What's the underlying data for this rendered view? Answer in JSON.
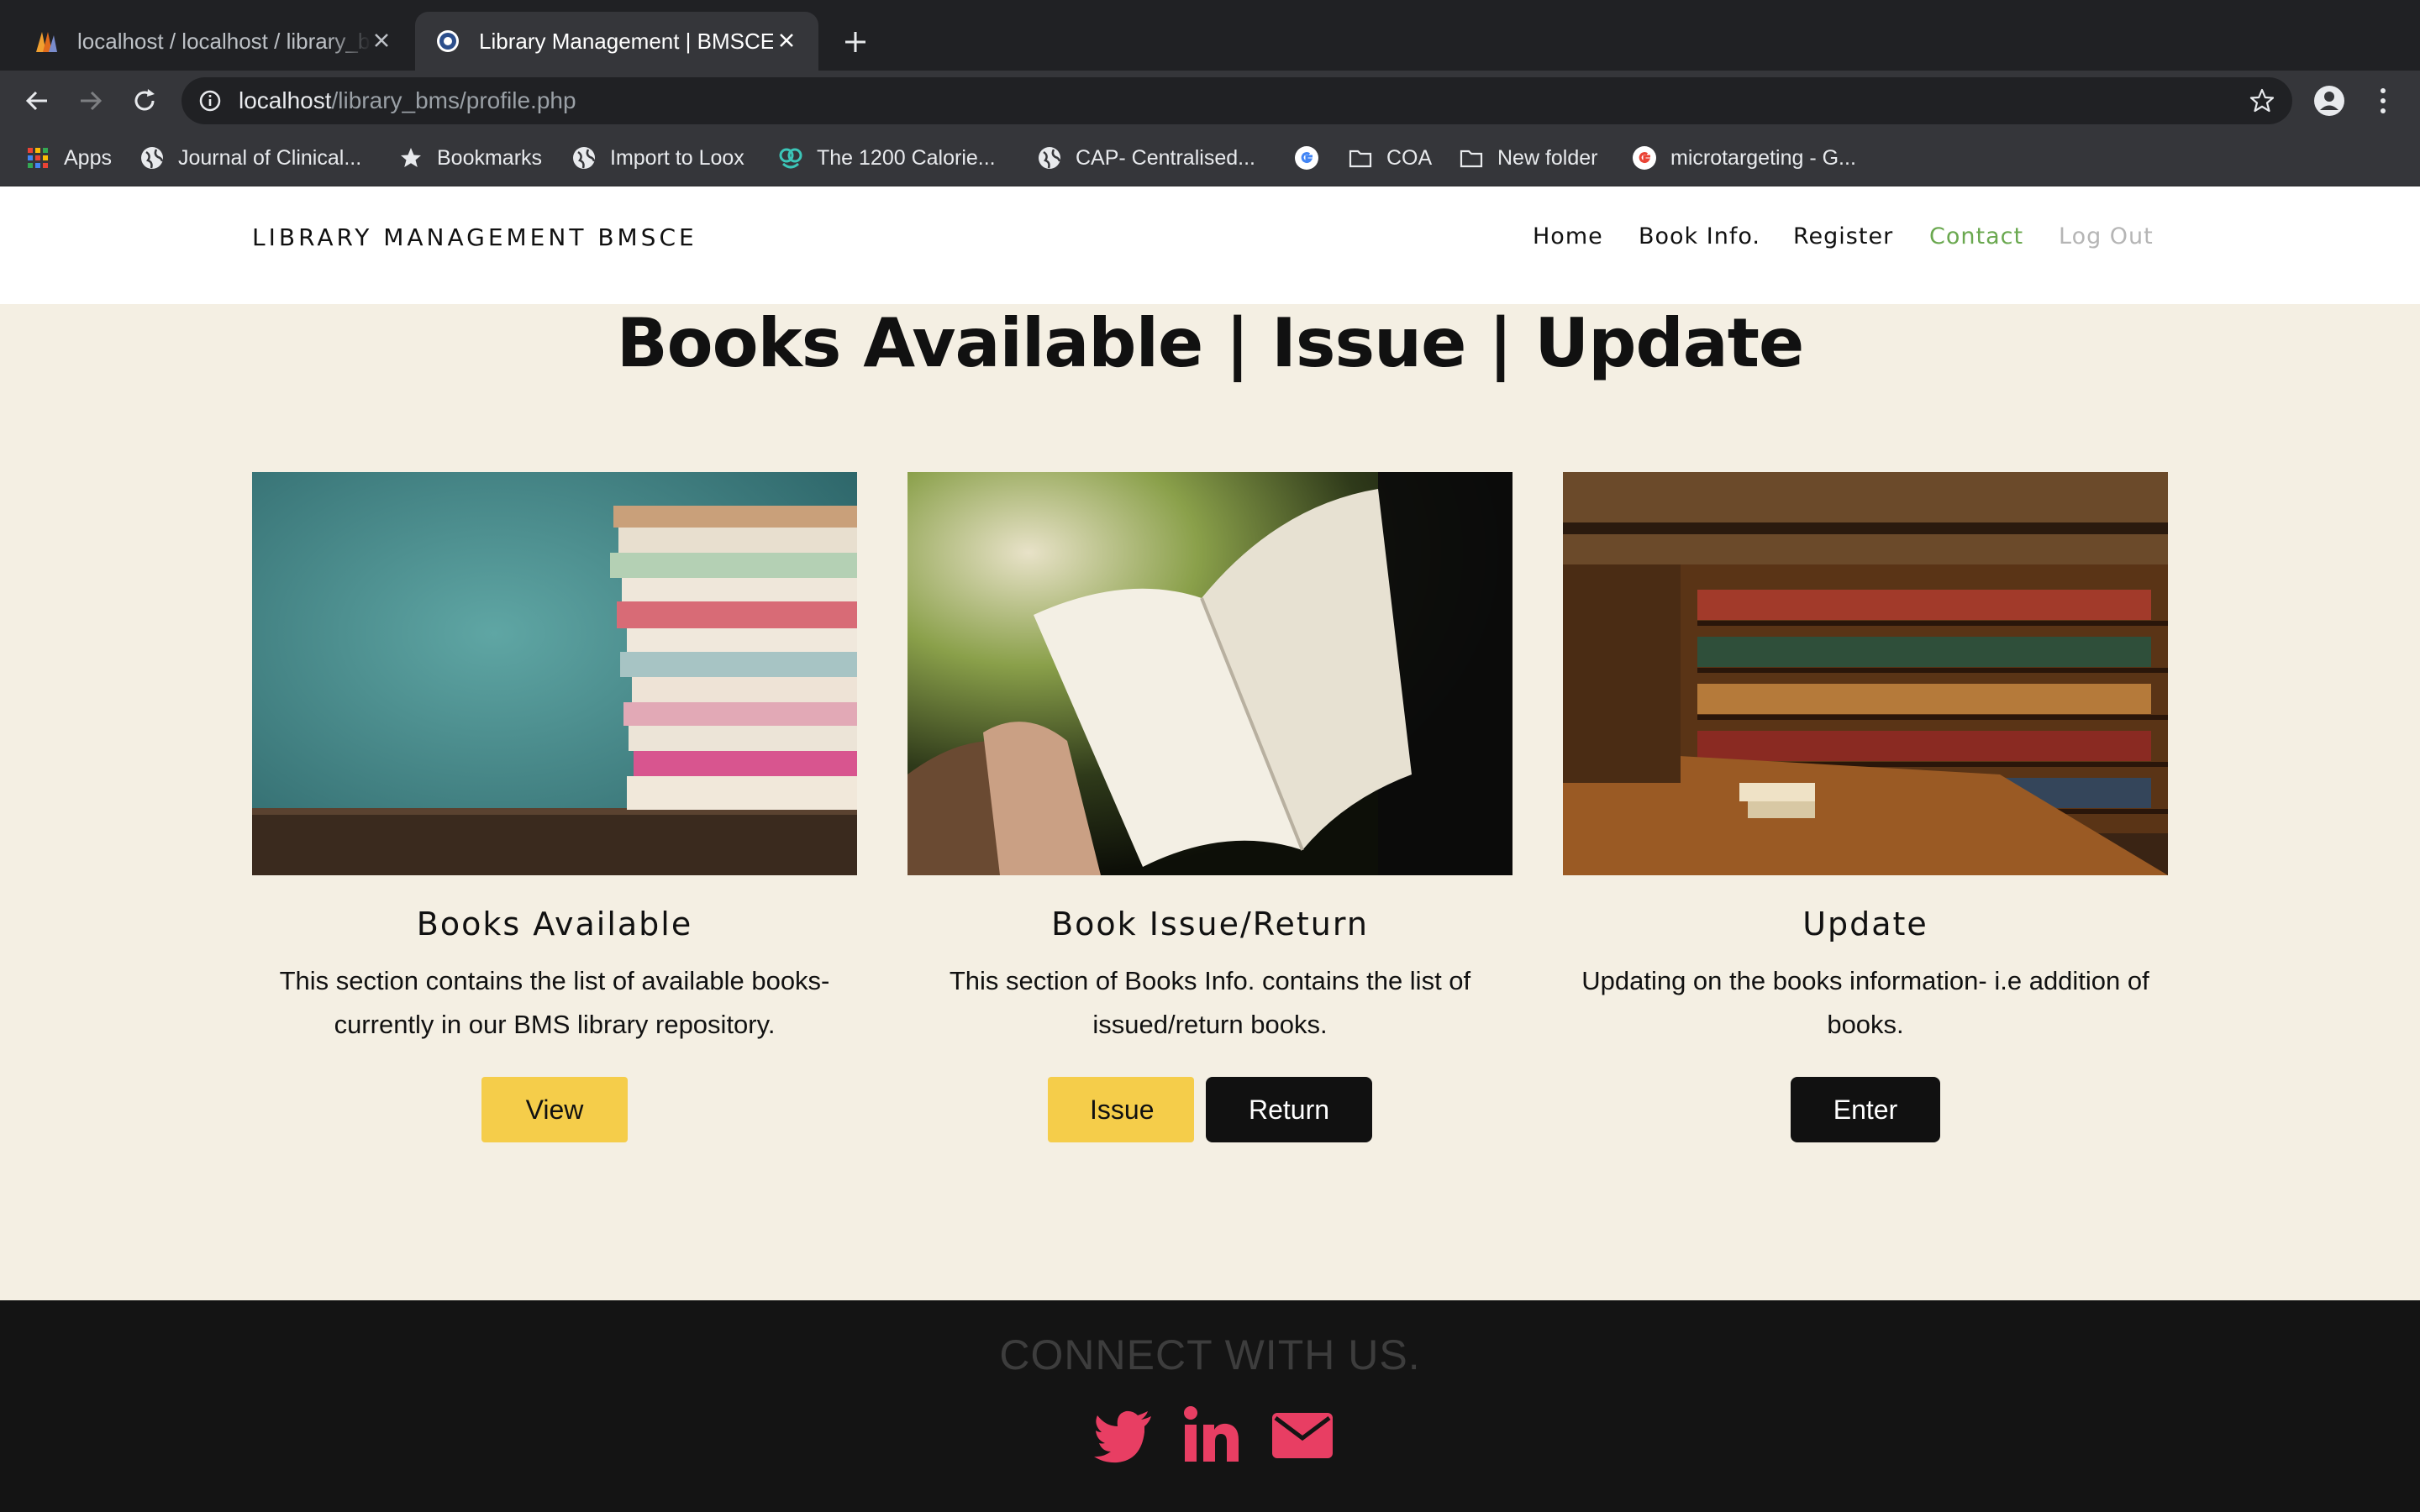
{
  "browser": {
    "tabs": [
      {
        "title": "localhost / localhost / library_bms"
      },
      {
        "title": "Library Management | BMSCE"
      }
    ],
    "url_host": "localhost",
    "url_path": "/library_bms/profile.php",
    "bookmarks": [
      {
        "label": "Apps",
        "icon": "apps-grid-icon"
      },
      {
        "label": "Journal of Clinical...",
        "icon": "globe-icon"
      },
      {
        "label": "Bookmarks",
        "icon": "star-icon"
      },
      {
        "label": "Import to Loox",
        "icon": "globe-icon"
      },
      {
        "label": "The 1200 Calorie...",
        "icon": "site-icon"
      },
      {
        "label": "CAP- Centralised...",
        "icon": "globe-icon"
      },
      {
        "label": "",
        "icon": "google-icon"
      },
      {
        "label": "COA",
        "icon": "folder-icon"
      },
      {
        "label": "New folder",
        "icon": "folder-icon"
      },
      {
        "label": "microtargeting - G...",
        "icon": "google-icon"
      }
    ]
  },
  "site": {
    "brand": "LIBRARY MANAGEMENT BMSCE",
    "nav": [
      "Home",
      "Book Info.",
      "Register",
      "Contact",
      "Log Out"
    ],
    "active_nav": "Contact",
    "heading": "Books Available | Issue | Update",
    "cards": [
      {
        "title": "Books Available",
        "desc": "This section contains the list of available books- currently in our BMS library repository.",
        "buttons": [
          "View"
        ]
      },
      {
        "title": "Book Issue/Return",
        "desc": "This section of Books Info. contains the list of issued/return books.",
        "buttons": [
          "Issue",
          "Return"
        ]
      },
      {
        "title": "Update",
        "desc": "Updating on the books information- i.e addition of books.",
        "buttons": [
          "Enter"
        ]
      }
    ],
    "footer_title": "CONNECT WITH US.",
    "social": [
      "twitter-icon",
      "linkedin-icon",
      "email-icon"
    ]
  },
  "colors": {
    "page_bg": "#f4efe3",
    "accent_yellow": "#f5cd4a",
    "active_link": "#6aa84f",
    "social_pink": "#e83e63",
    "footer_bg": "#141414"
  }
}
